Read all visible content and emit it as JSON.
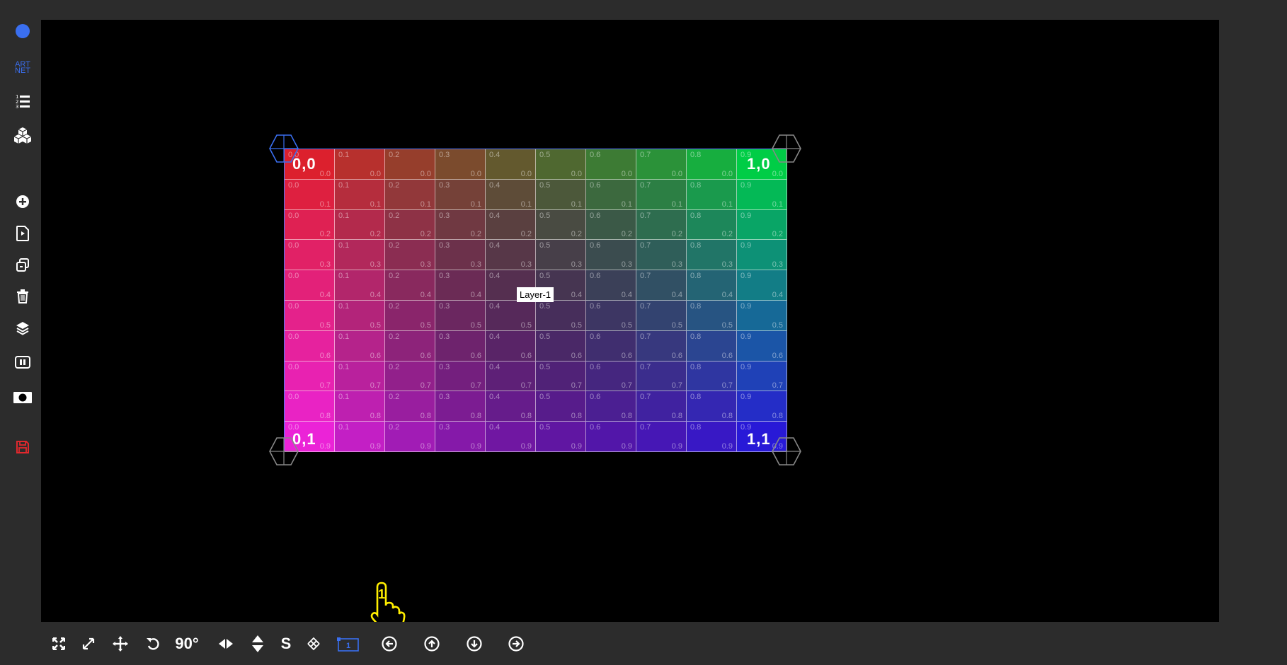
{
  "colors": {
    "accent": "#3a6ff0",
    "danger": "#e0282d",
    "pointer": "#ffee00",
    "stage_bg": "#000000",
    "chrome_bg": "#2c2c2c"
  },
  "sidebar": {
    "items": [
      {
        "name": "status-dot-icon"
      },
      {
        "name": "artnet-logo-icon",
        "label": "ART NET"
      },
      {
        "name": "numbered-list-icon"
      },
      {
        "name": "cubes-icon"
      },
      {
        "name": "add-circle-icon"
      },
      {
        "name": "play-file-icon"
      },
      {
        "name": "copy-icon"
      },
      {
        "name": "trash-icon"
      },
      {
        "name": "layers-icon"
      },
      {
        "name": "pause-box-icon"
      },
      {
        "name": "camera-icon"
      },
      {
        "name": "save-icon"
      }
    ]
  },
  "canvas": {
    "layer_label": "Layer-1",
    "corners": {
      "top_left": "0,0",
      "top_right": "1,0",
      "bottom_left": "0,1",
      "bottom_right": "1,1"
    },
    "grid": {
      "cols": 10,
      "rows": 10,
      "x_labels": [
        "0.0",
        "0.1",
        "0.2",
        "0.3",
        "0.4",
        "0.5",
        "0.6",
        "0.7",
        "0.8",
        "0.9"
      ],
      "y_labels": [
        "0.0",
        "0.1",
        "0.2",
        "0.3",
        "0.4",
        "0.5",
        "0.6",
        "0.7",
        "0.8",
        "0.9"
      ]
    }
  },
  "toolbar": {
    "items": [
      {
        "name": "fullscreen-icon"
      },
      {
        "name": "expand-diagonal-icon"
      },
      {
        "name": "move-icon"
      },
      {
        "name": "rotate-ccw-icon"
      },
      {
        "name": "rotate-90-button",
        "label": "90°"
      },
      {
        "name": "flip-horizontal-icon"
      },
      {
        "name": "flip-vertical-icon"
      },
      {
        "name": "s-button",
        "label": "S"
      },
      {
        "name": "crosshair-icon"
      },
      {
        "name": "layer-1-icon",
        "label": "1"
      },
      {
        "name": "arrow-left-circle-icon"
      },
      {
        "name": "arrow-up-circle-icon"
      },
      {
        "name": "arrow-down-circle-icon"
      },
      {
        "name": "arrow-right-circle-icon"
      }
    ]
  },
  "pointer": {
    "name": "hand-pointer-icon",
    "badge": "1"
  }
}
